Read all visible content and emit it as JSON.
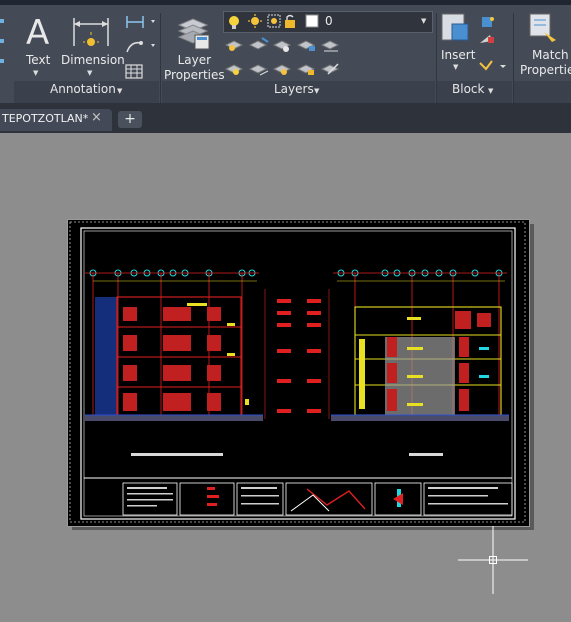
{
  "ribbon": {
    "annotation": {
      "text_label": "Text",
      "dimension_label": "Dimension",
      "panel_title": "Annotation"
    },
    "layers": {
      "layer_properties_label": "Layer\nProperties",
      "current_layer": "0",
      "panel_title": "Layers"
    },
    "block": {
      "insert_label": "Insert",
      "panel_title": "Block"
    },
    "properties": {
      "match_properties_label": "Match\nProperties"
    }
  },
  "tabs": {
    "document_tab": "TEPOTZOTLAN*",
    "new_tab": "+"
  },
  "colors": {
    "ribbon_bg": "#444b57",
    "canvas_bg": "#8d8d8d",
    "drawing_bg": "#000000",
    "accent_red": "#e02020",
    "accent_yellow": "#e8e020",
    "accent_cyan": "#22d8e0"
  }
}
